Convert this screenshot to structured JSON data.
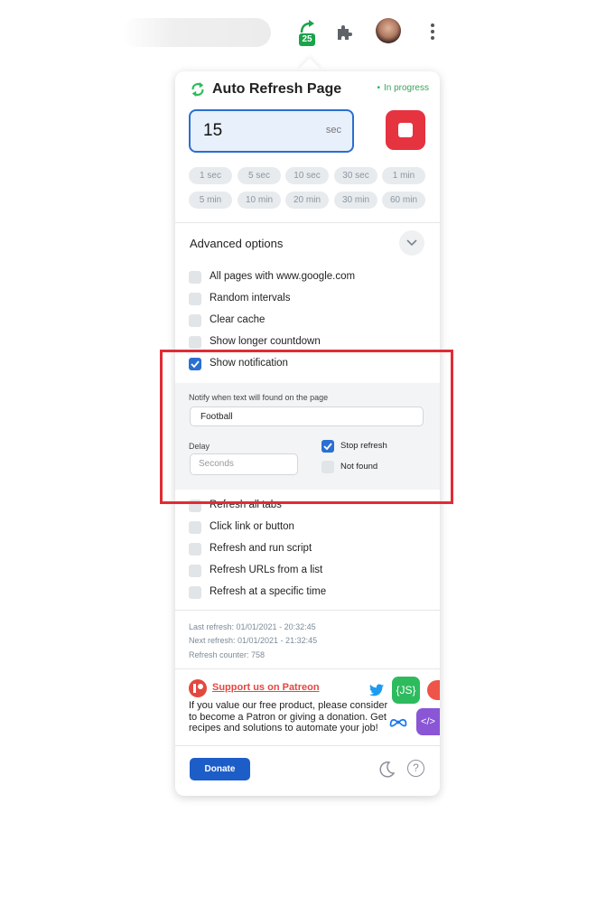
{
  "toolbar": {
    "extension_badge": "25",
    "icons": [
      "auto-refresh-extension-icon",
      "puzzle-icon",
      "avatar",
      "more-vert-icon"
    ]
  },
  "popup": {
    "title": "Auto Refresh Page",
    "status": "In progress",
    "interval": {
      "value": "15",
      "unit": "sec"
    },
    "presets": [
      "1 sec",
      "5 sec",
      "10 sec",
      "30 sec",
      "1 min",
      "5 min",
      "10 min",
      "20 min",
      "30 min",
      "60 min"
    ],
    "advanced": {
      "title": "Advanced options",
      "options": [
        {
          "label": "All pages with www.google.com",
          "checked": false
        },
        {
          "label": "Random intervals",
          "checked": false
        },
        {
          "label": "Clear cache",
          "checked": false
        },
        {
          "label": "Show longer countdown",
          "checked": false
        },
        {
          "label": "Show notification",
          "checked": true
        },
        {
          "label": "Refresh all tabs",
          "checked": false
        },
        {
          "label": "Click link or button",
          "checked": false
        },
        {
          "label": "Refresh and run script",
          "checked": false
        },
        {
          "label": "Refresh URLs from a list",
          "checked": false
        },
        {
          "label": "Refresh at a specific time",
          "checked": false
        }
      ]
    },
    "notification": {
      "caption": "Notify when text will found on the page",
      "text_value": "Football",
      "delay_label": "Delay",
      "delay_placeholder": "Seconds",
      "stop_refresh": {
        "label": "Stop refresh",
        "checked": true
      },
      "not_found": {
        "label": "Not found",
        "checked": false
      }
    },
    "stats": {
      "last_refresh": "Last refresh: 01/01/2021 - 20:32:45",
      "next_refresh": "Next refresh: 01/01/2021 - 21:32:45",
      "counter": "Refresh counter: 758"
    },
    "patreon": {
      "link": "Support us on Patreon",
      "text": "If you value our free product, please consider to become a Patron or giving a donation. Get recipes and solutions to automate your job!",
      "badges": {
        "js": "{JS}",
        "code": "</>"
      }
    },
    "footer": {
      "donate": "Donate",
      "help": "?"
    }
  },
  "colors": {
    "accent": "#2a6fd1",
    "stop": "#e53340",
    "success": "#2dbb5e",
    "patreon": "#e3483f",
    "highlight": "#e02c35"
  }
}
